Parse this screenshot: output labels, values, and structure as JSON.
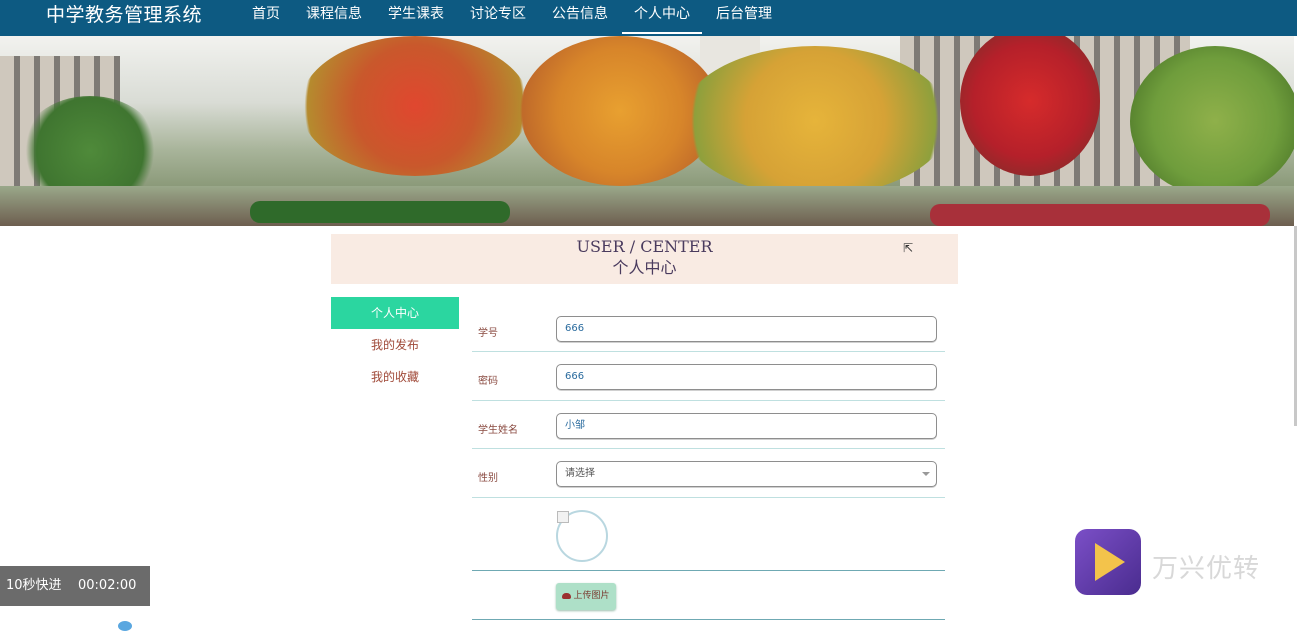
{
  "nav": {
    "brand": "中学教务管理系统",
    "items": [
      {
        "label": "首页",
        "active": false
      },
      {
        "label": "课程信息",
        "active": false
      },
      {
        "label": "学生课表",
        "active": false
      },
      {
        "label": "讨论专区",
        "active": false
      },
      {
        "label": "公告信息",
        "active": false
      },
      {
        "label": "个人中心",
        "active": true
      },
      {
        "label": "后台管理",
        "active": false
      }
    ]
  },
  "header": {
    "title_en": "USER / CENTER",
    "title_cn": "个人中心"
  },
  "left_menu": [
    {
      "label": "个人中心",
      "active": true
    },
    {
      "label": "我的发布",
      "active": false
    },
    {
      "label": "我的收藏",
      "active": false
    }
  ],
  "form": {
    "student_id": {
      "label": "学号",
      "value": "666"
    },
    "password": {
      "label": "密码",
      "value": "666"
    },
    "student_name": {
      "label": "学生姓名",
      "value": "小邹"
    },
    "gender": {
      "label": "性别",
      "value": "请选择"
    },
    "upload_label": "上传图片"
  },
  "overlay": {
    "fast_forward_label": "10秒快进",
    "time": "00:02:00",
    "watermark": "万兴优转"
  },
  "colors": {
    "nav_bg": "#0d5a82",
    "accent": "#2bd6a0",
    "header_bg": "#f9ebe3"
  }
}
